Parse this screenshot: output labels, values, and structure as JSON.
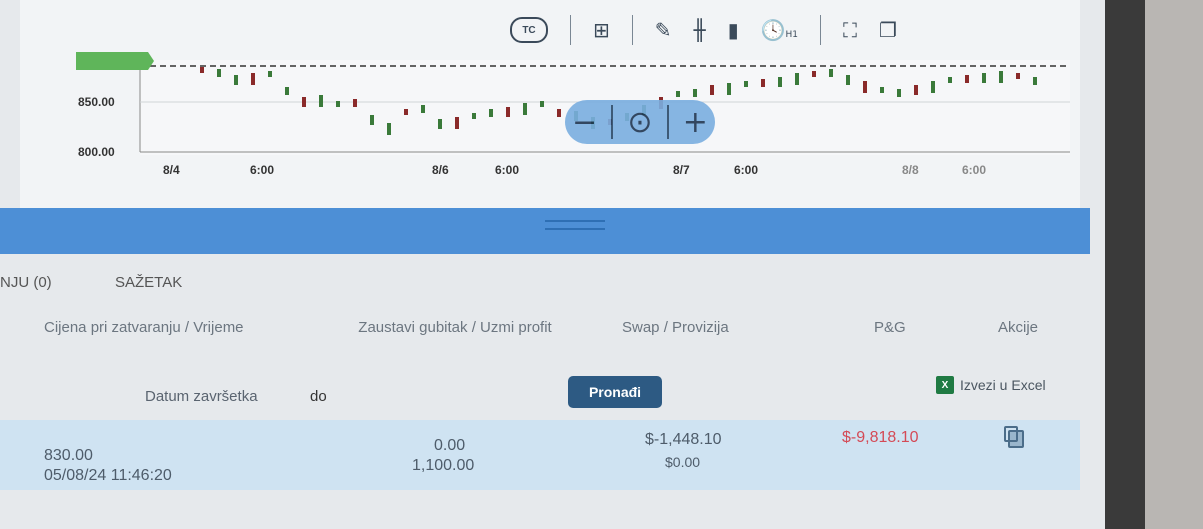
{
  "chart": {
    "y_ticks": [
      "850.00",
      "800.00"
    ],
    "x_ticks": [
      "8/4",
      "6:00",
      "8/6",
      "6:00",
      "8/7",
      "6:00",
      "8/8",
      "6:00"
    ],
    "zoom": {
      "minus": "−",
      "reset": "⊙",
      "plus": "+"
    },
    "accent": "#5fb55a"
  },
  "toolbar": {
    "tc_label": "TC",
    "grid_icon": "⊞",
    "draw_icon": "✎",
    "ohlc_icon": "╫",
    "bars_icon": "▮",
    "timeframe": "H1",
    "fullscreen_icon": "⛶",
    "window_icon": "❐"
  },
  "tabs": {
    "positions": "NJU (0)",
    "summary": "SAŽETAK"
  },
  "columns": {
    "close": "Cijena pri zatvaranju / Vrijeme",
    "stop": "Zaustavi gubitak / Uzmi profit",
    "swap": "Swap / Provizija",
    "pnl": "P&G",
    "actions": "Akcije"
  },
  "filter": {
    "end_date_label": "Datum završetka",
    "to_label": "do",
    "search_button": "Pronađi",
    "excel_label": "Izvezi u Excel",
    "excel_icon": "X"
  },
  "rows": [
    {
      "close_price": "830.00",
      "close_time": "05/08/24 11:46:20",
      "stop_loss": "0.00",
      "take_profit": "1,100.00",
      "swap": "$-1,448.10",
      "commission": "$0.00",
      "pnl": "$-9,818.10"
    }
  ]
}
